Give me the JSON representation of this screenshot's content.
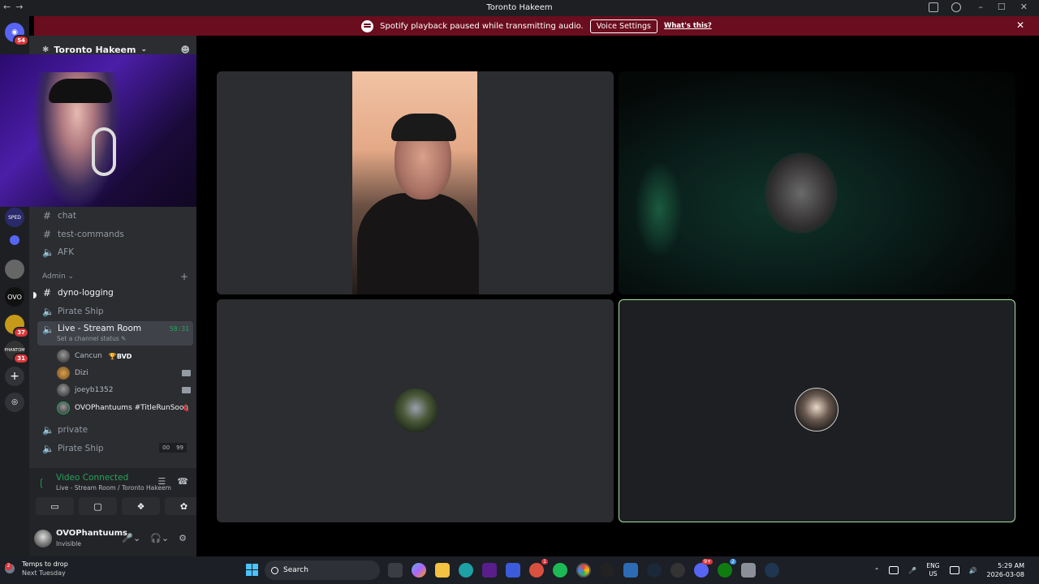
{
  "window": {
    "title": "Toronto Hakeem"
  },
  "banner": {
    "message": "Spotify playback paused while transmitting audio.",
    "button": "Voice Settings",
    "link": "What's this?",
    "color": "#6a0d1e"
  },
  "guilds": {
    "home_badge": "54",
    "badges": [
      "37",
      "31"
    ]
  },
  "server": {
    "name": "Toronto Hakeem"
  },
  "channels": {
    "top": [
      {
        "name": "chat",
        "type": "text"
      },
      {
        "name": "test-commands",
        "type": "text"
      },
      {
        "name": "AFK",
        "type": "voice"
      }
    ],
    "admin_category": "Admin",
    "admin": [
      {
        "name": "dyno-logging",
        "type": "text"
      },
      {
        "name": "Pirate Ship",
        "type": "voice"
      }
    ],
    "live": {
      "name": "Live - Stream Room",
      "timer": "58:31",
      "status": "Set a channel status"
    },
    "voice_users": [
      {
        "name": "Cancun",
        "tag": "BVD"
      },
      {
        "name": "Dizi"
      },
      {
        "name": "joeyb1352"
      },
      {
        "name": "OVOPhantuums #TitleRunSoon"
      }
    ],
    "bottom": [
      {
        "name": "private",
        "type": "voice"
      },
      {
        "name": "Pirate Ship",
        "type": "voice",
        "counts": [
          "00",
          "99"
        ]
      }
    ]
  },
  "voice_panel": {
    "status": "Video Connected",
    "location": "Live - Stream Room / Toronto Hakeem",
    "accent": "#23a559"
  },
  "user": {
    "name": "OVOPhantuums",
    "status": "Invisible"
  },
  "taskbar": {
    "weather_line1": "Temps to drop",
    "weather_line2": "Next Tuesday",
    "weather_badge": "2",
    "search_label": "Search",
    "lang1": "ENG",
    "lang2": "US",
    "time": "5:29 AM",
    "date": "2026-03-08",
    "app_badges": [
      "1",
      "9+",
      "2"
    ]
  }
}
